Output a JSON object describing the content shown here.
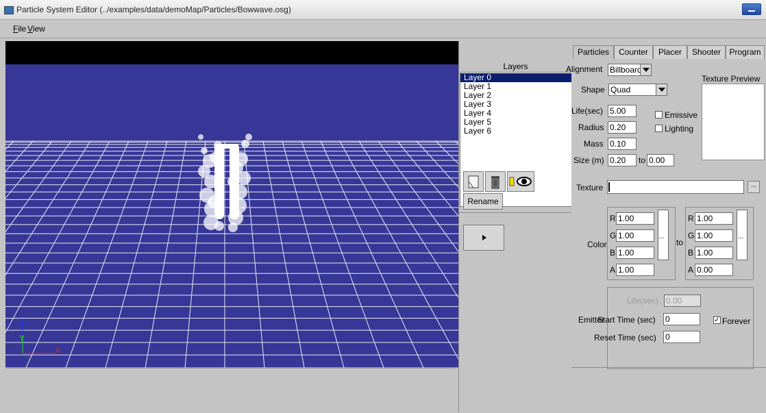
{
  "window": {
    "title": "Particle System Editor (../examples/data/demoMap/Particles/Bowwave.osg)"
  },
  "menu": [
    {
      "mnemonic": "F",
      "rest": "ile"
    },
    {
      "mnemonic": "V",
      "rest": "iew"
    }
  ],
  "viewport": {
    "axes": {
      "z": "Z",
      "y": "Y",
      "x": "X"
    },
    "colors": {
      "sky": "#363796",
      "grid": "#ffffff",
      "axis_z": "#2a3ad8",
      "axis_y": "#2ad82a",
      "axis_x": "#d82a2a"
    }
  },
  "layers": {
    "title": "Layers",
    "items": [
      "Layer 0",
      "Layer 1",
      "Layer 2",
      "Layer 3",
      "Layer 4",
      "Layer 5",
      "Layer 6"
    ],
    "selected": "Layer 0",
    "rename_label": "Rename"
  },
  "tabs": [
    "Particles",
    "Counter",
    "Placer",
    "Shooter",
    "Program"
  ],
  "active_tab": "Particles",
  "particles": {
    "alignment_label": "Alignment",
    "alignment_value": "Billboard",
    "shape_label": "Shape",
    "shape_value": "Quad",
    "texture_preview_label": "Texture Preview",
    "life_label": "Life(sec)",
    "life_value": "5.00",
    "radius_label": "Radius",
    "radius_value": "0.20",
    "mass_label": "Mass",
    "mass_value": "0.10",
    "size_label": "Size (m)",
    "size_from": "0.20",
    "size_to_label": "to",
    "size_to": "0.00",
    "emissive_label": "Emissive",
    "emissive_checked": false,
    "lighting_label": "Lighting",
    "lighting_checked": false,
    "texture_label": "Texture",
    "texture_value": "",
    "browse_label": "...",
    "color_label": "Color",
    "color_to_label": "to",
    "color_from": {
      "R": "1.00",
      "G": "1.00",
      "B": "1.00",
      "A": "1.00"
    },
    "color_to": {
      "R": "1.00",
      "G": "1.00",
      "B": "1.00",
      "A": "0.00"
    },
    "channel_labels": [
      "R",
      "G",
      "B",
      "A"
    ],
    "color_btn_label": "...",
    "emitter_label": "Emitter",
    "emitter_life_label": "Life(sec)",
    "emitter_life_value": "0.00",
    "start_time_label": "Start Time (sec)",
    "start_time_value": "0",
    "reset_time_label": "Reset Time (sec)",
    "reset_time_value": "0",
    "forever_label": "Forever",
    "forever_checked": true
  }
}
